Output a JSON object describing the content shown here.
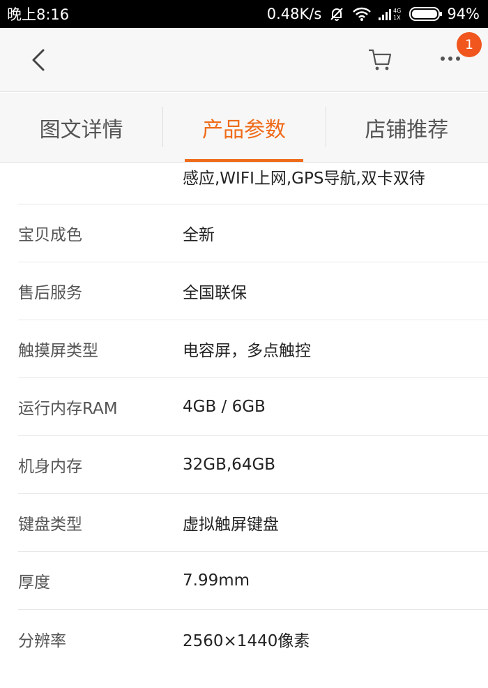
{
  "status_bar": {
    "time": "晚上8:16",
    "speed": "0.48K/s",
    "network": "4G 1X",
    "battery": "94%"
  },
  "nav": {
    "back_icon": "chevron-left-icon",
    "cart_icon": "cart-icon",
    "more_icon": "more-dots-icon",
    "badge_count": "1",
    "badge_color": "#f0561d"
  },
  "tabs": [
    {
      "label": "图文详情",
      "active": false
    },
    {
      "label": "产品参数",
      "active": true
    },
    {
      "label": "店铺推荐",
      "active": false
    }
  ],
  "accent_color": "#ef6b1a",
  "specs": {
    "first_value": "感应,WIFI上网,GPS导航,双卡双待",
    "rows": [
      {
        "label": "宝贝成色",
        "value": "全新"
      },
      {
        "label": "售后服务",
        "value": "全国联保"
      },
      {
        "label": "触摸屏类型",
        "value": "电容屏，多点触控"
      },
      {
        "label": "运行内存RAM",
        "value": "4GB / 6GB"
      },
      {
        "label": "机身内存",
        "value": "32GB,64GB"
      },
      {
        "label": "键盘类型",
        "value": "虚拟触屏键盘"
      },
      {
        "label": "厚度",
        "value": "7.99mm"
      },
      {
        "label": "分辨率",
        "value": "2560×1440像素"
      }
    ]
  }
}
